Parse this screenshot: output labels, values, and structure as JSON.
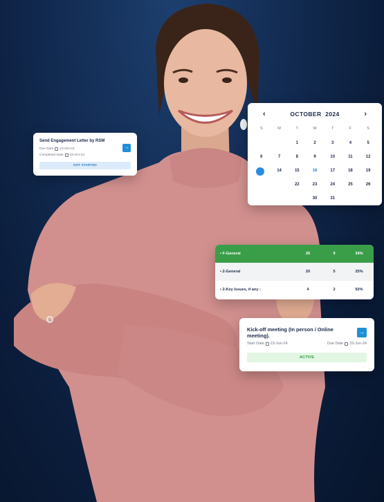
{
  "task_card": {
    "title": "Send Engagement Letter by RSM",
    "due_label": "Due Date",
    "due_value": "10-Oct-23",
    "completed_label": "Completed Date",
    "completed_value": "03-Oct-23",
    "status": "NOT STARTED",
    "go_icon": "arrow-right-icon"
  },
  "calendar": {
    "prev_icon": "‹",
    "next_icon": "›",
    "month": "OCTOBER",
    "year": "2024",
    "weekdays": [
      "S",
      "M",
      "T",
      "W",
      "T",
      "F",
      "S"
    ],
    "weeks": [
      [
        "",
        "",
        "1",
        "2",
        "3",
        "4",
        "5"
      ],
      [
        "6",
        "7",
        "8",
        "9",
        "10",
        "11",
        "12"
      ],
      [
        "13",
        "14",
        "15",
        "16",
        "17",
        "18",
        "19"
      ],
      [
        "",
        "",
        "22",
        "23",
        "24",
        "25",
        "26"
      ],
      [
        "",
        "",
        "",
        "30",
        "31",
        "",
        ""
      ]
    ],
    "today": "16",
    "selected": "13"
  },
  "stats_table": {
    "rows": [
      {
        "name": "F-General",
        "a": "26",
        "b": "9",
        "pct": "34%"
      },
      {
        "name": "2-General",
        "a": "20",
        "b": "5",
        "pct": "25%"
      },
      {
        "name": "2-Key Issues, if any ;",
        "a": "4",
        "b": "2",
        "pct": "50%"
      }
    ],
    "header_color": "#3a9e49"
  },
  "kickoff_card": {
    "title": "Kick-off meeting (In person / Online meeting).",
    "start_label": "Start Date",
    "start_value": "23-Jun-24",
    "due_label": "Due Date",
    "due_value": "23-Jun-24",
    "status": "ACTIVE",
    "go_icon": "arrow-right-icon"
  },
  "colors": {
    "background": "#0b1d3b",
    "accent": "#1f8fd6",
    "active": "#3a9e49"
  }
}
